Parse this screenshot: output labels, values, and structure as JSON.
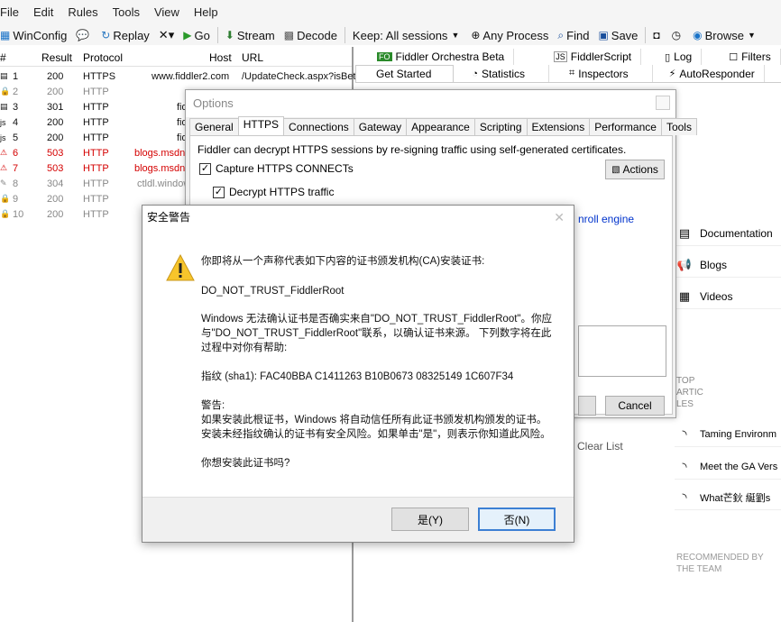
{
  "menu": [
    "File",
    "Edit",
    "Rules",
    "Tools",
    "View",
    "Help"
  ],
  "toolbar": {
    "winconfig": "WinConfig",
    "replay": "Replay",
    "remove": "✕▾",
    "go": "Go",
    "stream": "Stream",
    "decode": "Decode",
    "keep": "Keep: All sessions",
    "process": "Any Process",
    "find": "Find",
    "save": "Save",
    "browse": "Browse"
  },
  "sessions": {
    "headers": {
      "num": "#",
      "result": "Result",
      "protocol": "Protocol",
      "host": "Host",
      "url": "URL"
    },
    "rows": [
      {
        "num": "1",
        "result": "200",
        "protocol": "HTTPS",
        "host": "www.fiddler2.com",
        "url": "/UpdateCheck.aspx?isBet",
        "style": "black"
      },
      {
        "num": "2",
        "result": "200",
        "protocol": "HTTP",
        "host": "",
        "url": "",
        "style": "grey"
      },
      {
        "num": "3",
        "result": "301",
        "protocol": "HTTP",
        "host": "fid",
        "url": "",
        "style": "black"
      },
      {
        "num": "4",
        "result": "200",
        "protocol": "HTTP",
        "host": "fid",
        "url": "",
        "style": "black"
      },
      {
        "num": "5",
        "result": "200",
        "protocol": "HTTP",
        "host": "fid",
        "url": "",
        "style": "black"
      },
      {
        "num": "6",
        "result": "503",
        "protocol": "HTTP",
        "host": "blogs.msdn.",
        "url": "",
        "style": "red"
      },
      {
        "num": "7",
        "result": "503",
        "protocol": "HTTP",
        "host": "blogs.msdn.",
        "url": "",
        "style": "red"
      },
      {
        "num": "8",
        "result": "304",
        "protocol": "HTTP",
        "host": "ctldl.window",
        "url": "",
        "style": "grey"
      },
      {
        "num": "9",
        "result": "200",
        "protocol": "HTTP",
        "host": "",
        "url": "",
        "style": "grey"
      },
      {
        "num": "10",
        "result": "200",
        "protocol": "HTTP",
        "host": "",
        "url": "",
        "style": "grey"
      }
    ]
  },
  "right": {
    "tabs_row1": [
      "Fiddler Orchestra Beta",
      "FiddlerScript",
      "Log",
      "Filters"
    ],
    "tabs_row2": [
      "Get Started",
      "Statistics",
      "Inspectors",
      "AutoResponder"
    ],
    "links": [
      "Documentation",
      "Blogs",
      "Videos"
    ],
    "top_articles": [
      "TOP",
      "ARTIC",
      "LES"
    ],
    "articles": [
      "Taming Environm",
      "Meet the GA Vers",
      "What芒鈥 綖劉s"
    ],
    "clear_list": "Clear List",
    "recommended": [
      "RECOMMENDED BY",
      "THE TEAM"
    ]
  },
  "options": {
    "title": "Options",
    "tabs": [
      "General",
      "HTTPS",
      "Connections",
      "Gateway",
      "Appearance",
      "Scripting",
      "Extensions",
      "Performance",
      "Tools"
    ],
    "desc": "Fiddler can decrypt HTTPS sessions by re-signing traffic using self-generated certificates.",
    "capture": "Capture HTTPS CONNECTs",
    "decrypt": "Decrypt HTTPS traffic",
    "actions": "Actions",
    "link_partial": "nroll engine",
    "cancel": "Cancel"
  },
  "security": {
    "title": "安全警告",
    "close": "✕",
    "line1": "你即将从一个声称代表如下内容的证书颁发机构(CA)安装证书:",
    "cert_name": "DO_NOT_TRUST_FiddlerRoot",
    "para2_l1": "Windows 无法确认证书是否确实来自\"DO_NOT_TRUST_FiddlerRoot\"。你应",
    "para2_l2": "与\"DO_NOT_TRUST_FiddlerRoot\"联系，以确认证书来源。 下列数字将在此",
    "para2_l3": "过程中对你有帮助:",
    "thumbprint": "指纹 (sha1): FAC40BBA C1411263 B10B0673 08325149 1C607F34",
    "warn_label": "警告:",
    "warn_l1": "如果安装此根证书，Windows 将自动信任所有此证书颁发机构颁发的证书。",
    "warn_l2": "安装未经指纹确认的证书有安全风险。如果单击\"是\"，则表示你知道此风险。",
    "question": "你想安装此证书吗?",
    "yes": "是(Y)",
    "no": "否(N)"
  }
}
